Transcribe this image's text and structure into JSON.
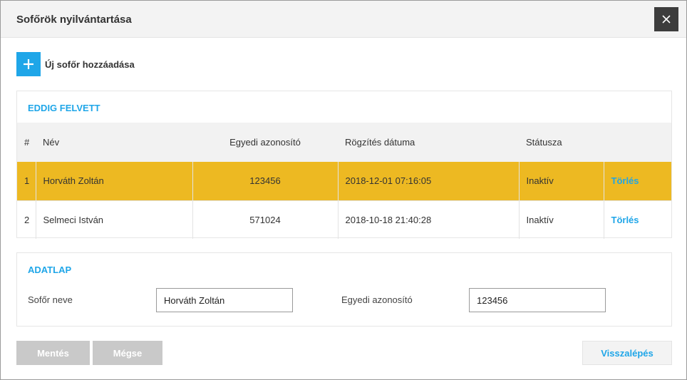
{
  "dialog": {
    "title": "Sofőrök nyilvántartása",
    "close_icon": "close-icon"
  },
  "add_driver": {
    "icon": "plus-icon",
    "label": "Új sofőr hozzáadása"
  },
  "list": {
    "title": "EDDIG FELVETT",
    "columns": [
      "#",
      "Név",
      "Egyedi azonosító",
      "Rögzítés dátuma",
      "Státusza",
      ""
    ],
    "rows": [
      {
        "index": "1",
        "name": "Horváth Zoltán",
        "id": "123456",
        "date": "2018-12-01 07:16:05",
        "status": "Inaktív",
        "action": "Törlés",
        "selected": true
      },
      {
        "index": "2",
        "name": "Selmeci István",
        "id": "571024",
        "date": "2018-10-18 21:40:28",
        "status": "Inaktív",
        "action": "Törlés",
        "selected": false
      }
    ]
  },
  "form": {
    "title": "ADATLAP",
    "name_label": "Sofőr neve",
    "name_value": "Horváth Zoltán",
    "id_label": "Egyedi azonosító",
    "id_value": "123456"
  },
  "buttons": {
    "save": "Mentés",
    "cancel": "Mégse",
    "back": "Visszalépés"
  },
  "colors": {
    "accent": "#1fa6e8",
    "selected_row": "#edb922",
    "header_bg": "#f3f3f3",
    "close_bg": "#3d3d3d"
  }
}
